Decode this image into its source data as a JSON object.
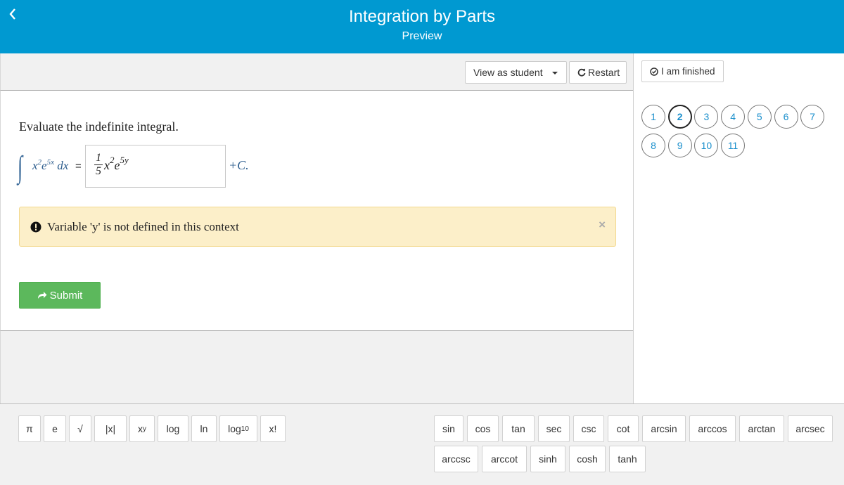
{
  "header": {
    "title": "Integration by Parts",
    "subtitle": "Preview"
  },
  "toolbar": {
    "view_as_label": "View as student",
    "restart_label": "Restart"
  },
  "sidebar": {
    "finished_label": "I am finished",
    "current_question": "2",
    "questions": [
      "1",
      "2",
      "3",
      "4",
      "5",
      "6",
      "7",
      "8",
      "9",
      "10",
      "11"
    ]
  },
  "question": {
    "prompt": "Evaluate the indefinite integral.",
    "integrand_base1": "x",
    "integrand_exp1": "2",
    "integrand_base2": "e",
    "integrand_exp2": "5x",
    "integrand_dx": "dx",
    "equals": "=",
    "answer": {
      "numerator": "1",
      "denominator": "5",
      "base1": "x",
      "exp1": "2",
      "base2": "e",
      "exp2": "5y"
    },
    "plus_c": "+C."
  },
  "alert": {
    "message": "Variable 'y' is not defined in this context",
    "close": "×"
  },
  "submit_label": "Submit",
  "keyboard": {
    "left_keys": [
      {
        "id": "pi",
        "label": "π"
      },
      {
        "id": "e",
        "label": "e"
      },
      {
        "id": "sqrt",
        "label": "√"
      },
      {
        "id": "abs",
        "label": "|x|"
      },
      {
        "id": "pow_base",
        "label": "x"
      },
      {
        "id": "pow_exp",
        "label": "y"
      },
      {
        "id": "log",
        "label": "log"
      },
      {
        "id": "ln",
        "label": "ln"
      },
      {
        "id": "log10_base",
        "label": "log"
      },
      {
        "id": "log10_sub",
        "label": "10"
      },
      {
        "id": "fact",
        "label": "x!"
      }
    ],
    "right_row1": [
      "sin",
      "cos",
      "tan",
      "sec",
      "csc",
      "cot",
      "arcsin",
      "arccos",
      "arctan",
      "arcsec"
    ],
    "right_row2": [
      "arccsc",
      "arccot",
      "sinh",
      "cosh",
      "tanh"
    ]
  },
  "colors": {
    "header": "#0099d1",
    "submit": "#5cb85c",
    "alert_bg": "#fcefc9",
    "link": "#1a8fcc"
  }
}
